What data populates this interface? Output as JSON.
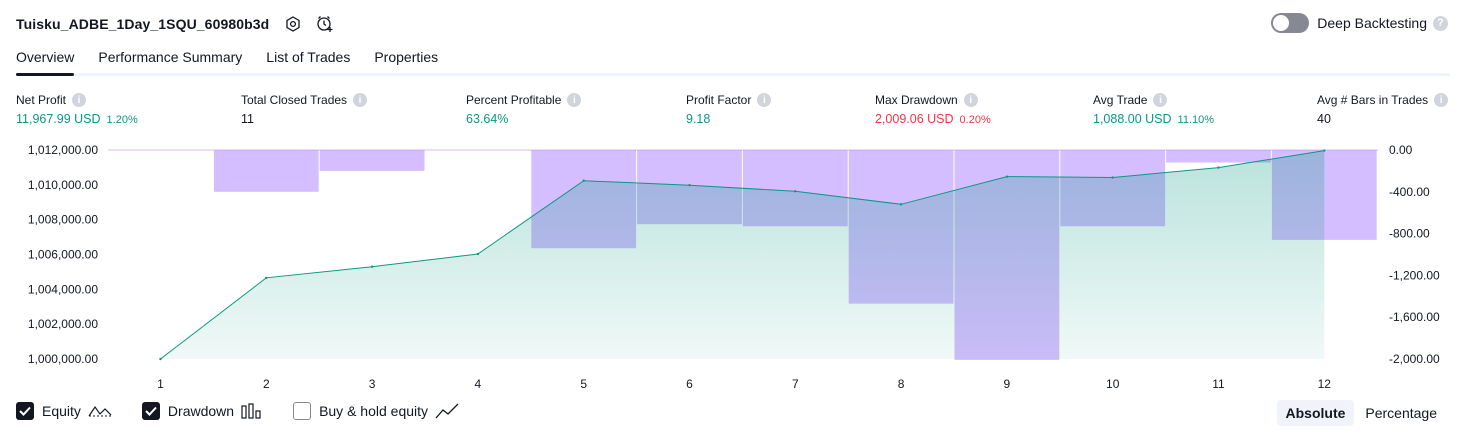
{
  "header": {
    "title": "Tuisku_ADBE_1Day_1SQU_60980b3d",
    "deep_backtesting_label": "Deep Backtesting"
  },
  "tabs": [
    {
      "label": "Overview",
      "active": true
    },
    {
      "label": "Performance Summary",
      "active": false
    },
    {
      "label": "List of Trades",
      "active": false
    },
    {
      "label": "Properties",
      "active": false
    }
  ],
  "metrics": {
    "net_profit": {
      "label": "Net Profit",
      "value": "11,967.99 USD",
      "pct": "1.20%"
    },
    "total_closed_trades": {
      "label": "Total Closed Trades",
      "value": "11"
    },
    "percent_profitable": {
      "label": "Percent Profitable",
      "value": "63.64%"
    },
    "profit_factor": {
      "label": "Profit Factor",
      "value": "9.18"
    },
    "max_drawdown": {
      "label": "Max Drawdown",
      "value": "2,009.06 USD",
      "pct": "0.20%"
    },
    "avg_trade": {
      "label": "Avg Trade",
      "value": "1,088.00 USD",
      "pct": "11.10%"
    },
    "avg_bars": {
      "label": "Avg # Bars in Trades",
      "value": "40"
    }
  },
  "chart_data": {
    "type": "area",
    "x": [
      1,
      2,
      3,
      4,
      5,
      6,
      7,
      8,
      9,
      10,
      11,
      12
    ],
    "y_left_ticks": [
      "1,012,000.00",
      "1,010,000.00",
      "1,008,000.00",
      "1,006,000.00",
      "1,004,000.00",
      "1,002,000.00",
      "1,000,000.00"
    ],
    "y_left_values": [
      1012000,
      1010000,
      1008000,
      1006000,
      1004000,
      1002000,
      1000000
    ],
    "y_right_ticks": [
      "0.00",
      "-400.00",
      "-800.00",
      "-1,200.00",
      "-1,600.00",
      "-2,000.00"
    ],
    "y_right_values": [
      0,
      -400,
      -800,
      -1200,
      -1600,
      -2000
    ],
    "ylim_left": [
      1000000,
      1012000
    ],
    "ylim_right": [
      -2000,
      0
    ],
    "series": [
      {
        "name": "Equity",
        "type": "area",
        "axis": "left",
        "values": [
          1000000,
          1004660,
          1005300,
          1006030,
          1010240,
          1009980,
          1009630,
          1008880,
          1010470,
          1010420,
          1010990,
          1011968
        ]
      },
      {
        "name": "Drawdown",
        "type": "bar",
        "axis": "right",
        "values": [
          0,
          -400,
          -200,
          0,
          -940,
          -710,
          -730,
          -1470,
          -2009,
          -730,
          -120,
          -860
        ]
      }
    ],
    "colors": {
      "equity_line": "#089981",
      "equity_fill": "#089981",
      "drawdown": "#b388ff"
    }
  },
  "legend": [
    {
      "label": "Equity",
      "checked": true,
      "icon": "equity-line-icon"
    },
    {
      "label": "Drawdown",
      "checked": true,
      "icon": "drawdown-bars-icon"
    },
    {
      "label": "Buy & hold equity",
      "checked": false,
      "icon": "buy-hold-line-icon"
    }
  ],
  "mode": {
    "absolute_label": "Absolute",
    "percentage_label": "Percentage",
    "selected": "Absolute"
  }
}
